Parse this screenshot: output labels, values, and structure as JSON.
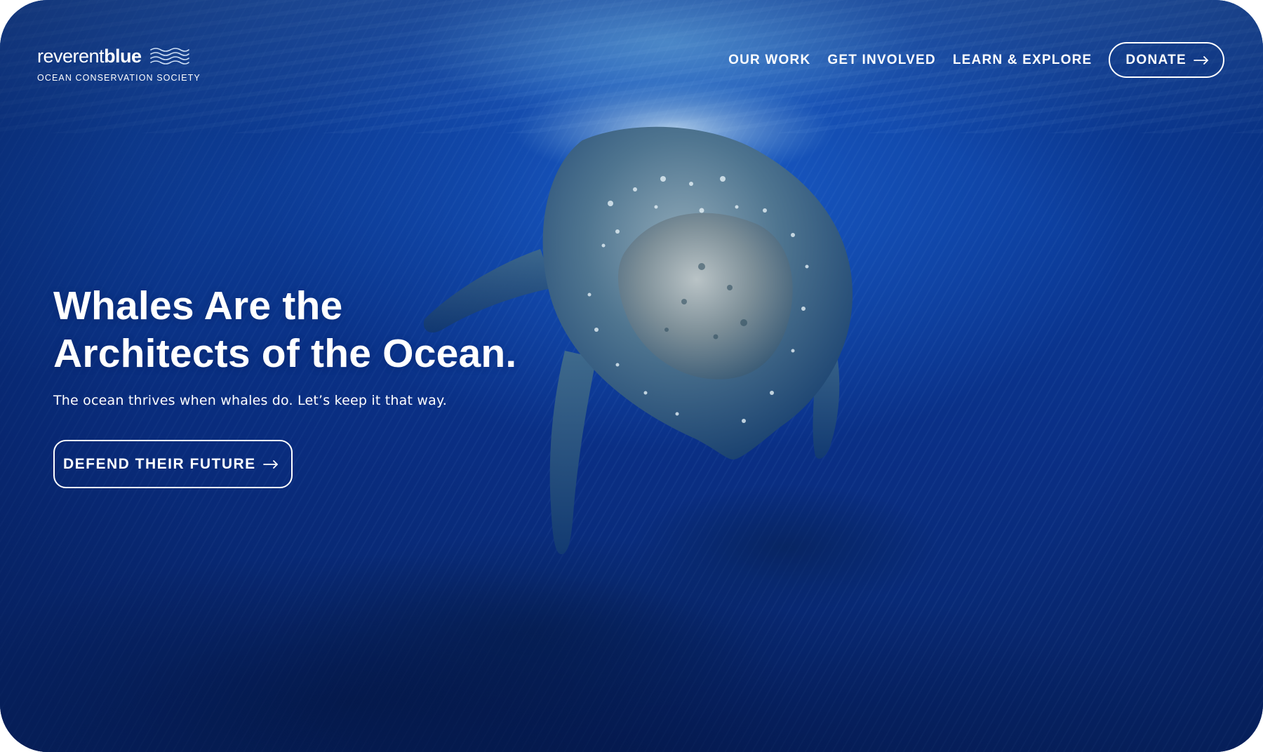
{
  "brand": {
    "name_light": "reverent",
    "name_bold": "blue",
    "tagline": "OCEAN CONSERVATION SOCIETY",
    "logo_icon": "waves-icon"
  },
  "nav": {
    "items": [
      {
        "label": "OUR WORK"
      },
      {
        "label": "GET INVOLVED"
      },
      {
        "label": "LEARN & EXPLORE"
      }
    ],
    "donate_label": "DONATE",
    "donate_icon": "arrow-right-icon"
  },
  "hero": {
    "title_line1": "Whales Are the",
    "title_line2": "Architects of the Ocean.",
    "subtitle": "The ocean thrives when whales do. Let’s keep it that way.",
    "cta_label": "DEFEND THEIR FUTURE",
    "cta_icon": "arrow-right-icon",
    "background_image": "humpback whale underwater"
  },
  "colors": {
    "ocean_blue": "#0a3a98",
    "text": "#ffffff"
  }
}
